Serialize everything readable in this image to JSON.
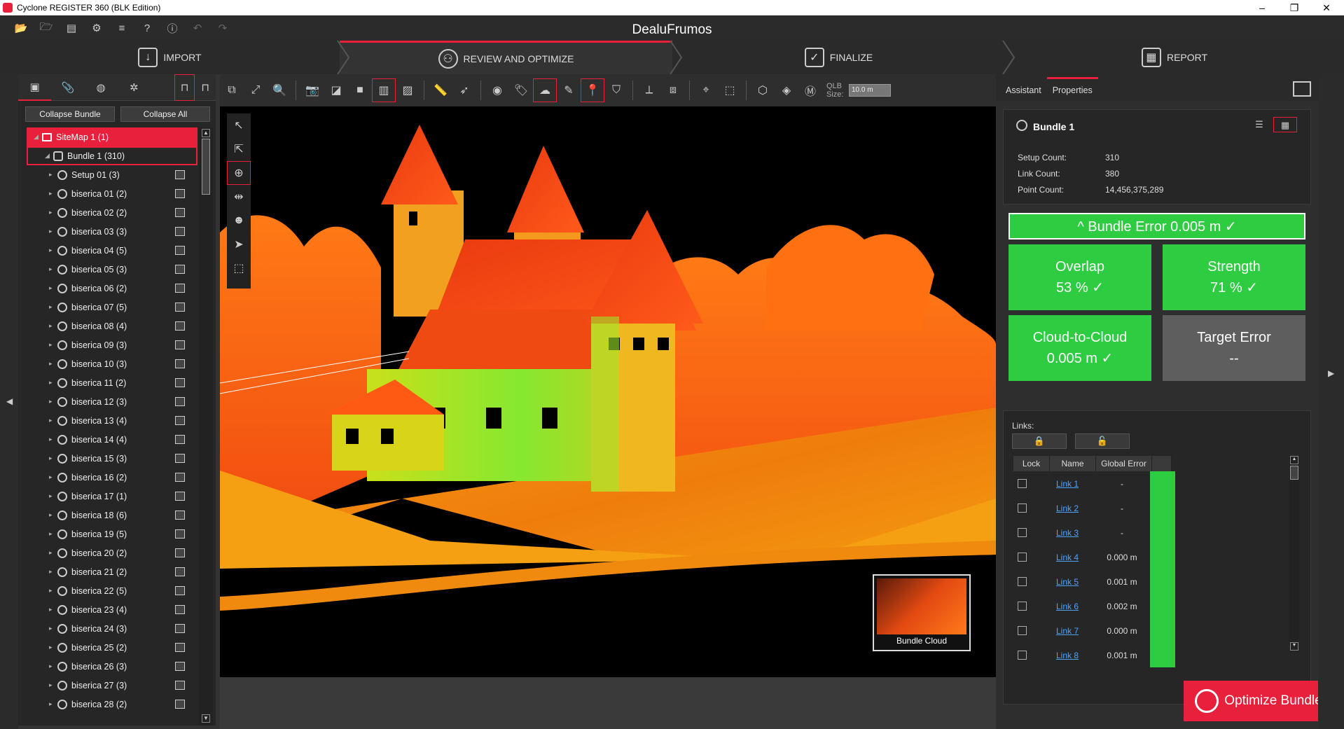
{
  "app_title": "Cyclone REGISTER 360 (BLK Edition)",
  "doc_title": "DealuFrumos",
  "workflow": [
    "IMPORT",
    "REVIEW AND OPTIMIZE",
    "FINALIZE",
    "REPORT"
  ],
  "left_panel": {
    "collapse_bundle": "Collapse Bundle",
    "collapse_all": "Collapse All",
    "sitemap": "SiteMap 1 (1)",
    "bundle": "Bundle 1 (310)",
    "setups": [
      "Setup 01 (3)",
      "biserica 01 (2)",
      "biserica 02 (2)",
      "biserica 03 (3)",
      "biserica 04 (5)",
      "biserica 05 (3)",
      "biserica 06 (2)",
      "biserica 07 (5)",
      "biserica 08 (4)",
      "biserica 09 (3)",
      "biserica 10 (3)",
      "biserica 11 (2)",
      "biserica 12 (3)",
      "biserica 13 (4)",
      "biserica 14 (4)",
      "biserica 15 (3)",
      "biserica 16 (2)",
      "biserica 17 (1)",
      "biserica 18 (6)",
      "biserica 19 (5)",
      "biserica 20 (2)",
      "biserica 21 (2)",
      "biserica 22 (5)",
      "biserica 23 (4)",
      "biserica 24 (3)",
      "biserica 25 (2)",
      "biserica 26 (3)",
      "biserica 27 (3)",
      "biserica 28 (2)"
    ]
  },
  "toolbar": {
    "qlb_label": "QLB Size:",
    "qlb_value": "10.0 m"
  },
  "viewport": {
    "thumbnail_label": "Bundle Cloud"
  },
  "right_panel": {
    "tabs": [
      "Assistant",
      "Properties"
    ],
    "bundle_name": "Bundle 1",
    "setup_count_label": "Setup Count:",
    "setup_count": "310",
    "link_count_label": "Link Count:",
    "link_count": "380",
    "point_count_label": "Point Count:",
    "point_count": "14,456,375,289",
    "bundle_error": "^ Bundle Error 0.005 m   ✓",
    "overlap_label": "Overlap",
    "overlap_value": "53 %   ✓",
    "strength_label": "Strength",
    "strength_value": "71 %   ✓",
    "c2c_label": "Cloud-to-Cloud",
    "c2c_value": "0.005 m   ✓",
    "target_label": "Target Error",
    "target_value": "--",
    "links_label": "Links:",
    "col_lock": "Lock",
    "col_name": "Name",
    "col_error": "Global Error",
    "links": [
      {
        "name": "Link 1",
        "error": "-"
      },
      {
        "name": "Link 2",
        "error": "-"
      },
      {
        "name": "Link 3",
        "error": "-"
      },
      {
        "name": "Link 4",
        "error": "0.000 m"
      },
      {
        "name": "Link 5",
        "error": "0.001 m"
      },
      {
        "name": "Link 6",
        "error": "0.002 m"
      },
      {
        "name": "Link 7",
        "error": "0.000 m"
      },
      {
        "name": "Link 8",
        "error": "0.001 m"
      }
    ],
    "optimize": "Optimize Bundle"
  }
}
